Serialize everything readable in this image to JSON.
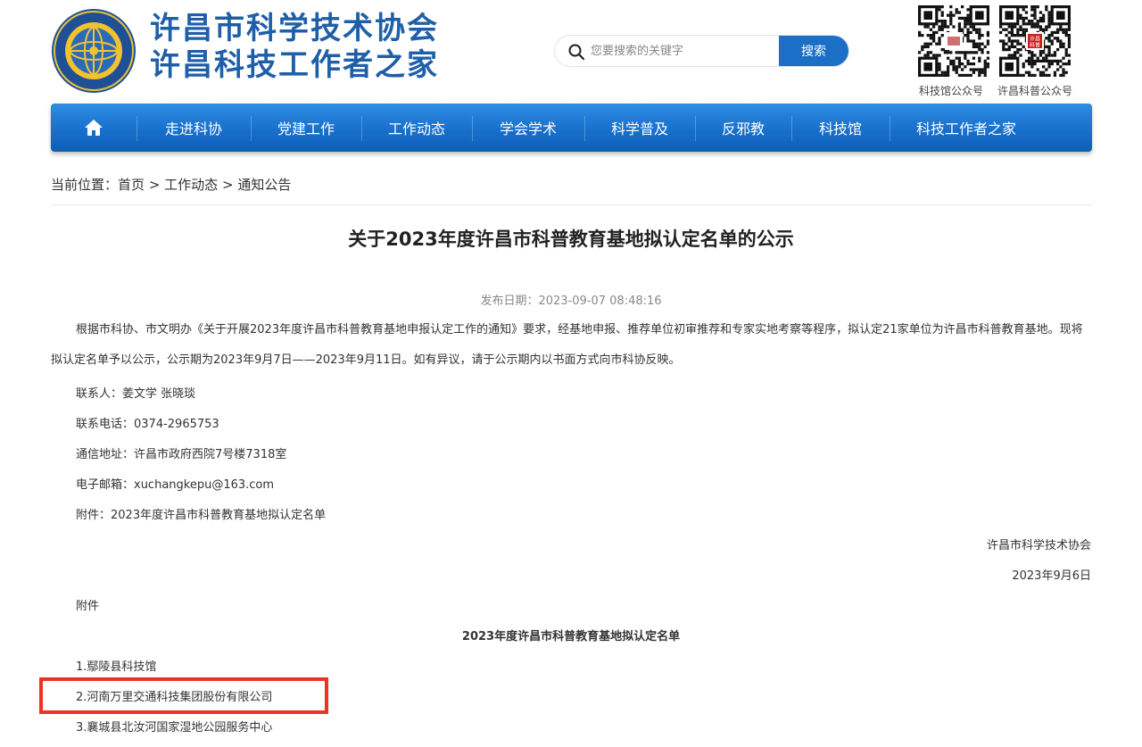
{
  "header": {
    "title_line1": "许昌市科学技术协会",
    "title_line2": "许昌科技工作者之家",
    "search": {
      "placeholder": "您要搜索的关键字",
      "button": "搜索"
    },
    "qr_codes": [
      {
        "label": "科技馆公众号",
        "badge": ""
      },
      {
        "label": "许昌科普公众号",
        "badge": "许昌科普"
      }
    ]
  },
  "nav": {
    "home_icon": "home-icon",
    "items": [
      "走进科协",
      "党建工作",
      "工作动态",
      "学会学术",
      "科学普及",
      "反邪教",
      "科技馆",
      "科技工作者之家"
    ]
  },
  "breadcrumb": {
    "prefix": "当前位置：",
    "items": [
      "首页",
      "工作动态",
      "通知公告"
    ],
    "separator": ">"
  },
  "article": {
    "title": "关于2023年度许昌市科普教育基地拟认定名单的公示",
    "publish_label": "发布日期：",
    "publish_date": "2023-09-07 08:48:16",
    "body_paragraph": "根据市科协、市文明办《关于开展2023年度许昌市科普教育基地申报认定工作的通知》要求，经基地申报、推荐单位初审推荐和专家实地考察等程序，拟认定21家单位为许昌市科普教育基地。现将拟认定名单予以公示，公示期为2023年9月7日——2023年9月11日。如有异议，请于公示期内以书面方式向市科协反映。",
    "contact_person": "联系人：姜文学 张晓琰",
    "contact_phone": "联系电话：0374-2965753",
    "address": "通信地址：许昌市政府西院7号楼7318室",
    "email": "电子邮箱：xuchangkepu@163.com",
    "attachment_note": "附件：2023年度许昌市科普教育基地拟认定名单",
    "signature_org": "许昌市科学技术协会",
    "signature_date": "2023年9月6日",
    "attachment_heading": "附件",
    "list_title": "2023年度许昌市科普教育基地拟认定名单",
    "list_items": [
      "1.鄢陵县科技馆",
      "2.河南万里交通科技集团股份有限公司",
      "3.襄城县北汝河国家湿地公园服务中心"
    ]
  },
  "colors": {
    "brand_blue": "#1f5fa8",
    "nav_blue": "#1870cc",
    "search_button": "#1b6fc6",
    "highlight_red": "#ee3322"
  }
}
